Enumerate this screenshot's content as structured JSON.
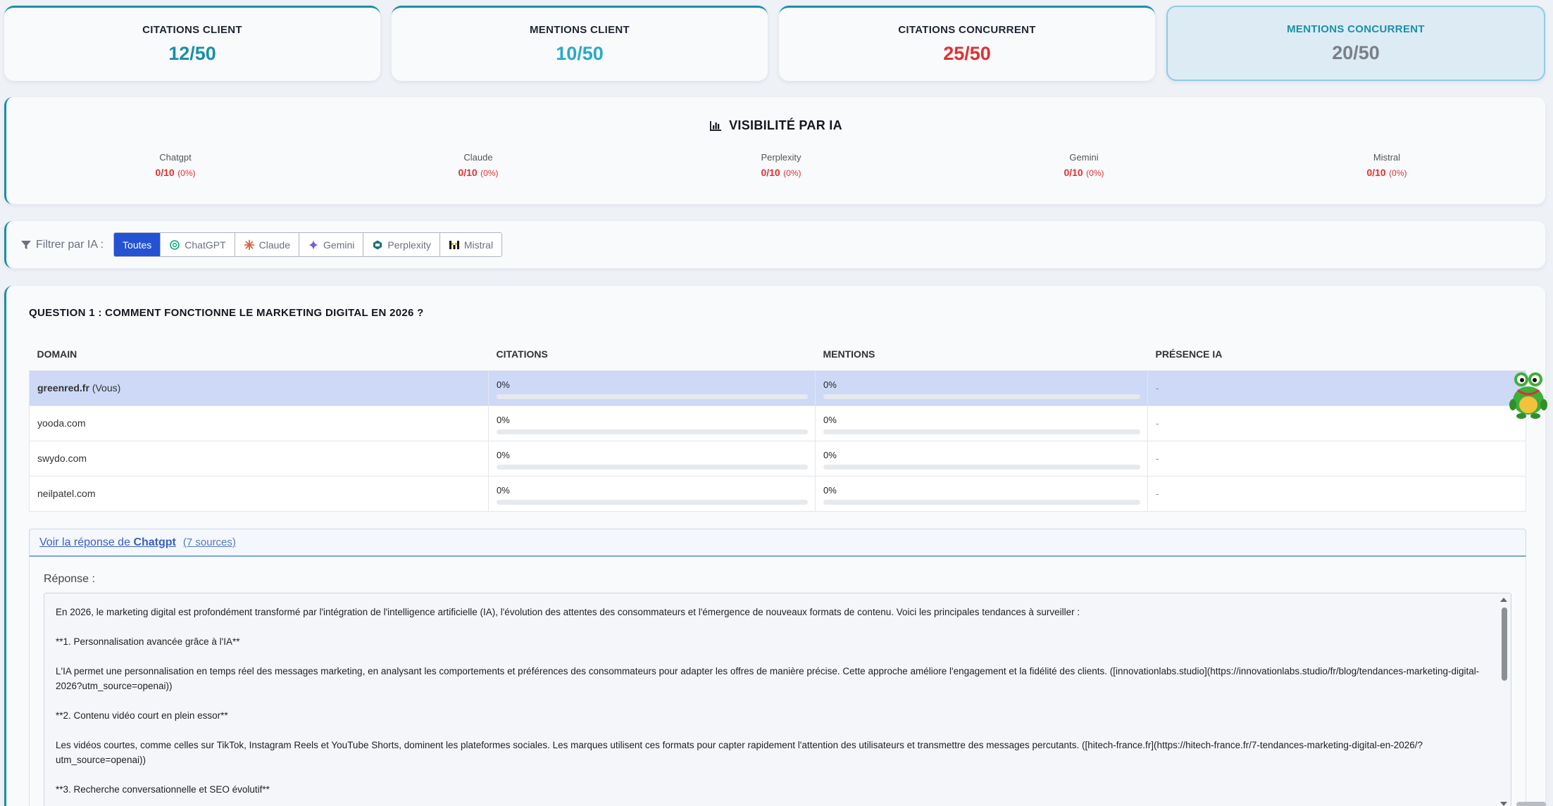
{
  "kpis": [
    {
      "label": "CITATIONS CLIENT",
      "value": "12/50",
      "color": "#1a8fa8",
      "active": false
    },
    {
      "label": "MENTIONS CLIENT",
      "value": "10/50",
      "color": "#2aa9c7",
      "active": false
    },
    {
      "label": "CITATIONS CONCURRENT",
      "value": "25/50",
      "color": "#e03131",
      "active": false
    },
    {
      "label": "MENTIONS CONCURRENT",
      "value": "20/50",
      "color": "#7a7f88",
      "active": true
    }
  ],
  "visibility": {
    "title": "VISIBILITÉ PAR IA",
    "items": [
      {
        "name": "Chatgpt",
        "score": "0/10",
        "pct": "(0%)"
      },
      {
        "name": "Claude",
        "score": "0/10",
        "pct": "(0%)"
      },
      {
        "name": "Perplexity",
        "score": "0/10",
        "pct": "(0%)"
      },
      {
        "name": "Gemini",
        "score": "0/10",
        "pct": "(0%)"
      },
      {
        "name": "Mistral",
        "score": "0/10",
        "pct": "(0%)"
      }
    ]
  },
  "filter": {
    "label": "Filtrer par IA :",
    "buttons": [
      {
        "label": "Toutes",
        "icon": "",
        "active": true
      },
      {
        "label": "ChatGPT",
        "icon": "chatgpt-icon",
        "active": false
      },
      {
        "label": "Claude",
        "icon": "claude-icon",
        "active": false
      },
      {
        "label": "Gemini",
        "icon": "gemini-icon",
        "active": false
      },
      {
        "label": "Perplexity",
        "icon": "perplexity-icon",
        "active": false
      },
      {
        "label": "Mistral",
        "icon": "mistral-icon",
        "active": false
      }
    ]
  },
  "question": {
    "title": "QUESTION 1 : COMMENT FONCTIONNE LE MARKETING DIGITAL EN 2026 ?",
    "columns": [
      "DOMAIN",
      "CITATIONS",
      "MENTIONS",
      "PRÉSENCE IA"
    ],
    "rows": [
      {
        "domain": "greenred.fr",
        "suffix": "(Vous)",
        "citations": "0%",
        "citations_fill": 0,
        "mentions": "0%",
        "mentions_fill": 0,
        "presence": "-",
        "me": true
      },
      {
        "domain": "yooda.com",
        "suffix": "",
        "citations": "0%",
        "citations_fill": 0,
        "mentions": "0%",
        "mentions_fill": 0,
        "presence": "-",
        "me": false
      },
      {
        "domain": "swydo.com",
        "suffix": "",
        "citations": "0%",
        "citations_fill": 0,
        "mentions": "0%",
        "mentions_fill": 0,
        "presence": "-",
        "me": false
      },
      {
        "domain": "neilpatel.com",
        "suffix": "",
        "citations": "0%",
        "citations_fill": 0,
        "mentions": "0%",
        "mentions_fill": 0,
        "presence": "-",
        "me": false
      }
    ],
    "answer_link_prefix": "Voir la réponse de",
    "answer_link_ai": "Chatgpt",
    "answer_sources": "(7 sources)",
    "answer_label": "Réponse :",
    "answer_paragraphs": [
      "En 2026, le marketing digital est profondément transformé par l'intégration de l'intelligence artificielle (IA), l'évolution des attentes des consommateurs et l'émergence de nouveaux formats de contenu. Voici les principales tendances à surveiller :",
      "**1. Personnalisation avancée grâce à l'IA**",
      "L'IA permet une personnalisation en temps réel des messages marketing, en analysant les comportements et préférences des consommateurs pour adapter les offres de manière précise. Cette approche améliore l'engagement et la fidélité des clients. ([innovationlabs.studio](https://innovationlabs.studio/fr/blog/tendances-marketing-digital-2026?utm_source=openai))",
      "**2. Contenu vidéo court en plein essor**",
      "Les vidéos courtes, comme celles sur TikTok, Instagram Reels et YouTube Shorts, dominent les plateformes sociales. Les marques utilisent ces formats pour capter rapidement l'attention des utilisateurs et transmettre des messages percutants. ([hitech-france.fr](https://hitech-france.fr/7-tendances-marketing-digital-en-2026/?utm_source=openai))",
      "**3. Recherche conversationnelle et SEO évolutif**"
    ]
  }
}
